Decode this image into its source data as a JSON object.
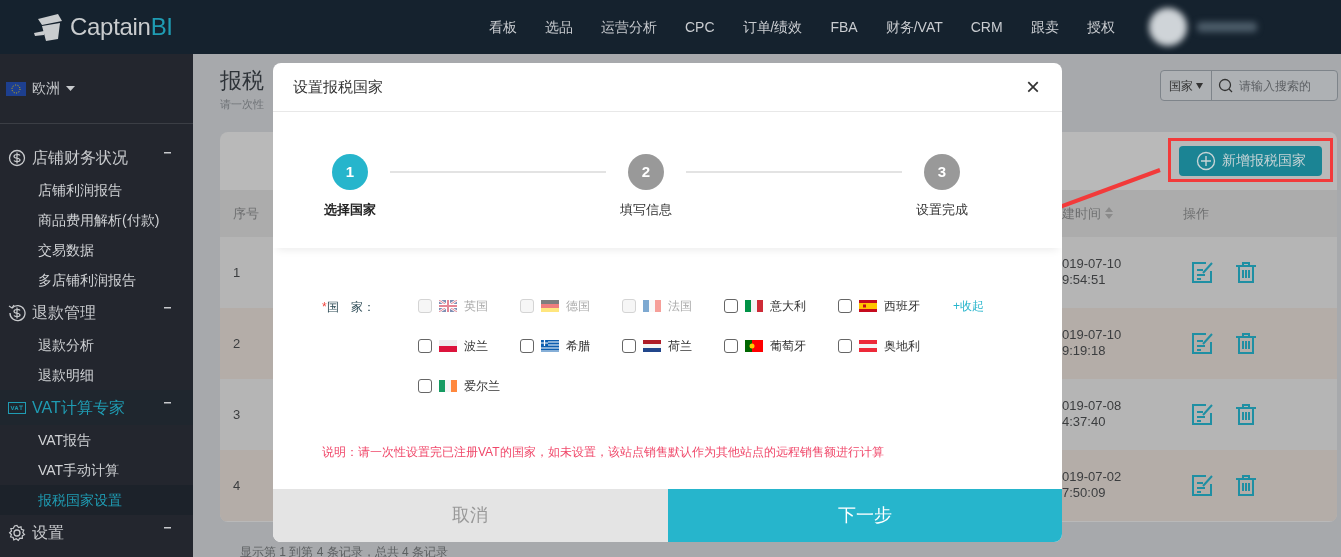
{
  "logo": {
    "text": "Captain",
    "accent": "BI"
  },
  "top_nav": [
    {
      "label": "看板"
    },
    {
      "label": "选品"
    },
    {
      "label": "运营分析"
    },
    {
      "label": "CPC"
    },
    {
      "label": "订单/绩效"
    },
    {
      "label": "FBA"
    },
    {
      "label": "财务/VAT"
    },
    {
      "label": "CRM"
    },
    {
      "label": "跟卖"
    },
    {
      "label": "授权"
    }
  ],
  "sidebar": {
    "region": "欧洲",
    "groups": [
      {
        "label": "店铺财务状况",
        "kind": "dollar",
        "expanded": true,
        "selected": false,
        "children": [
          {
            "label": "店铺利润报告",
            "selected": false
          },
          {
            "label": "商品费用解析(付款)",
            "selected": false
          },
          {
            "label": "交易数据",
            "selected": false
          },
          {
            "label": "多店铺利润报告",
            "selected": false
          }
        ]
      },
      {
        "label": "退款管理",
        "kind": "refund",
        "expanded": true,
        "selected": false,
        "children": [
          {
            "label": "退款分析",
            "selected": false
          },
          {
            "label": "退款明细",
            "selected": false
          }
        ]
      },
      {
        "label": "VAT计算专家",
        "kind": "vat",
        "expanded": true,
        "selected": true,
        "children": [
          {
            "label": "VAT报告",
            "selected": false
          },
          {
            "label": "VAT手动计算",
            "selected": false
          },
          {
            "label": "报税国家设置",
            "selected": true
          }
        ]
      },
      {
        "label": "设置",
        "kind": "gear",
        "expanded": true,
        "selected": false
      }
    ]
  },
  "page": {
    "title": "报税",
    "subtitle": "请一次性",
    "search": {
      "filter": "国家",
      "placeholder": "请输入搜索的"
    },
    "add_button": "新增报税国家"
  },
  "table": {
    "columns": [
      "序号",
      "建时间",
      "操作"
    ],
    "rows": [
      {
        "index": "1",
        "date": "019-07-10",
        "time": "9:54:51"
      },
      {
        "index": "2",
        "date": "019-07-10",
        "time": "9:19:18"
      },
      {
        "index": "3",
        "date": "019-07-08",
        "time": "4:37:40"
      },
      {
        "index": "4",
        "date": "019-07-02",
        "time": "7:50:09"
      }
    ],
    "footer": "显示第 1 到第 4 条记录，总共 4 条记录"
  },
  "dialog": {
    "title": "设置报税国家",
    "close": "×",
    "steps": [
      {
        "number": "1",
        "label": "选择国家",
        "selected": true
      },
      {
        "number": "2",
        "label": "填写信息",
        "selected": false
      },
      {
        "number": "3",
        "label": "设置完成",
        "selected": false
      }
    ],
    "required_mark": "*",
    "field_label": "国　家：",
    "countries": [
      {
        "name": "英国",
        "checked": false,
        "disabled": true,
        "kind": "uk"
      },
      {
        "name": "德国",
        "checked": false,
        "disabled": true,
        "kind": "germany"
      },
      {
        "name": "法国",
        "checked": false,
        "disabled": true,
        "kind": "france"
      },
      {
        "name": "意大利",
        "checked": false,
        "disabled": false,
        "kind": "italy"
      },
      {
        "name": "西班牙",
        "checked": false,
        "disabled": false,
        "kind": "spain"
      },
      {
        "name": "波兰",
        "checked": false,
        "disabled": false,
        "kind": "poland"
      },
      {
        "name": "希腊",
        "checked": false,
        "disabled": false,
        "kind": "greece"
      },
      {
        "name": "荷兰",
        "checked": false,
        "disabled": false,
        "kind": "netherlands"
      },
      {
        "name": "葡萄牙",
        "checked": false,
        "disabled": false,
        "kind": "portugal"
      },
      {
        "name": "奥地利",
        "checked": false,
        "disabled": false,
        "kind": "austria"
      },
      {
        "name": "爱尔兰",
        "checked": false,
        "disabled": false,
        "kind": "ireland"
      }
    ],
    "collapse_link": "+收起",
    "note": "说明：请一次性设置完已注册VAT的国家，如未设置，该站点销售默认作为其他站点的远程销售额进行计算",
    "buttons": {
      "cancel": "取消",
      "next": "下一步"
    }
  }
}
